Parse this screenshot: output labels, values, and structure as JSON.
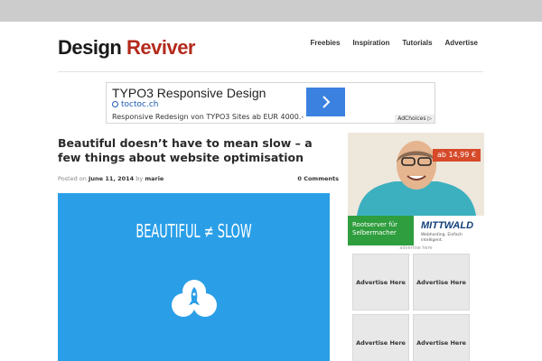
{
  "site": {
    "logo_word1": "Design",
    "logo_word2": "Reviver"
  },
  "nav": {
    "items": [
      "Freebies",
      "Inspiration",
      "Tutorials",
      "Advertise"
    ]
  },
  "top_ad": {
    "title": "TYPO3 Responsive Design",
    "domain": "toctoc.ch",
    "description": "Responsive Redesign von TYPO3 Sites ab EUR 4000.-",
    "choices_label": "AdChoices"
  },
  "post": {
    "title": "Beautiful doesn’t have to mean slow – a few things about website optimisation",
    "posted_on_label": "Posted on",
    "date": "June 11, 2014",
    "by_label": "by",
    "author": "marie",
    "comments": "0 Comments",
    "hero_text": "BEAUTIFUL ≠ SLOW"
  },
  "side_ad": {
    "price": "ab 14,99 €",
    "green_line1": "Rootserver für",
    "green_line2": "Selbermacher",
    "brand": "MITTWALD",
    "brand_tagline": "Webhosting. Einfach intelligent.",
    "advertise_small": "advertise here"
  },
  "ad_boxes": {
    "label": "Advertise Here"
  },
  "colors": {
    "brand_red": "#b32a1c",
    "hero_blue": "#2a9fe8",
    "link_blue": "#3b82e0",
    "mittwald_green": "#2f9e3e"
  }
}
